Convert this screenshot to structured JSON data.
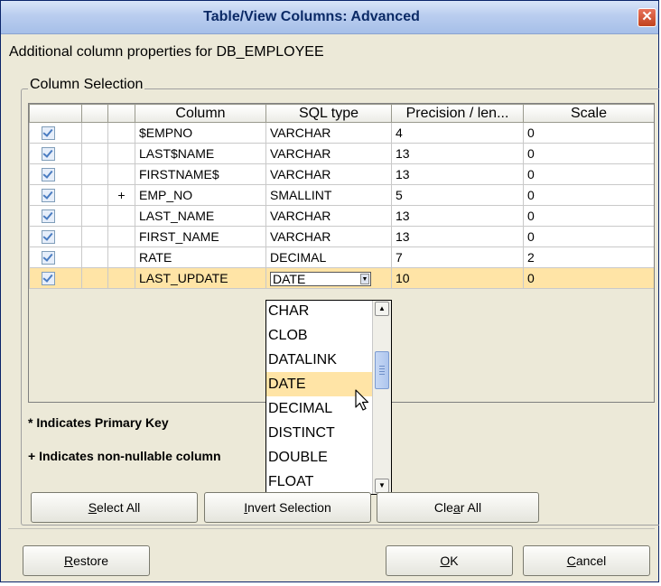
{
  "window": {
    "title": "Table/View Columns: Advanced",
    "close_glyph": "✕"
  },
  "description": "Additional column properties for DB_EMPLOYEE",
  "group": {
    "title": "Column Selection"
  },
  "table": {
    "headers": [
      "",
      "",
      "",
      "Column",
      "SQL type",
      "Precision / len...",
      "Scale"
    ],
    "rows": [
      {
        "checked": true,
        "pk": "",
        "nn": "",
        "column": "$EMPNO",
        "sql_type": "VARCHAR",
        "precision": "4",
        "scale": "0"
      },
      {
        "checked": true,
        "pk": "",
        "nn": "",
        "column": "LAST$NAME",
        "sql_type": "VARCHAR",
        "precision": "13",
        "scale": "0"
      },
      {
        "checked": true,
        "pk": "",
        "nn": "",
        "column": "FIRSTNAME$",
        "sql_type": "VARCHAR",
        "precision": "13",
        "scale": "0"
      },
      {
        "checked": true,
        "pk": "",
        "nn": "+",
        "column": "EMP_NO",
        "sql_type": "SMALLINT",
        "precision": "5",
        "scale": "0"
      },
      {
        "checked": true,
        "pk": "",
        "nn": "",
        "column": "LAST_NAME",
        "sql_type": "VARCHAR",
        "precision": "13",
        "scale": "0"
      },
      {
        "checked": true,
        "pk": "",
        "nn": "",
        "column": "FIRST_NAME",
        "sql_type": "VARCHAR",
        "precision": "13",
        "scale": "0"
      },
      {
        "checked": true,
        "pk": "",
        "nn": "",
        "column": "RATE",
        "sql_type": "DECIMAL",
        "precision": "7",
        "scale": "2"
      },
      {
        "checked": true,
        "pk": "",
        "nn": "",
        "column": "LAST_UPDATE",
        "sql_type": "DATE",
        "precision": "10",
        "scale": "0",
        "selected": true,
        "editing": true
      }
    ]
  },
  "dropdown": {
    "options": [
      "CHAR",
      "CLOB",
      "DATALINK",
      "DATE",
      "DECIMAL",
      "DISTINCT",
      "DOUBLE",
      "FLOAT"
    ],
    "highlighted": "DATE"
  },
  "notes": {
    "primary_key": "* Indicates Primary Key",
    "non_nullable": "+ Indicates non-nullable column"
  },
  "buttons": {
    "select_all": {
      "before": "",
      "mnemonic": "S",
      "after": "elect All"
    },
    "invert_selection": {
      "before": "",
      "mnemonic": "I",
      "after": "nvert Selection"
    },
    "clear_all": {
      "before": "Cle",
      "mnemonic": "a",
      "after": "r All"
    },
    "restore": {
      "before": "",
      "mnemonic": "R",
      "after": "estore"
    },
    "ok": {
      "before": "",
      "mnemonic": "O",
      "after": "K"
    },
    "cancel": {
      "before": "",
      "mnemonic": "C",
      "after": "ancel"
    }
  },
  "colors": {
    "selection": "#ffe4a6",
    "dialog_bg": "#ece9d8",
    "title_text": "#0b2a66",
    "close": "#c1421e"
  }
}
